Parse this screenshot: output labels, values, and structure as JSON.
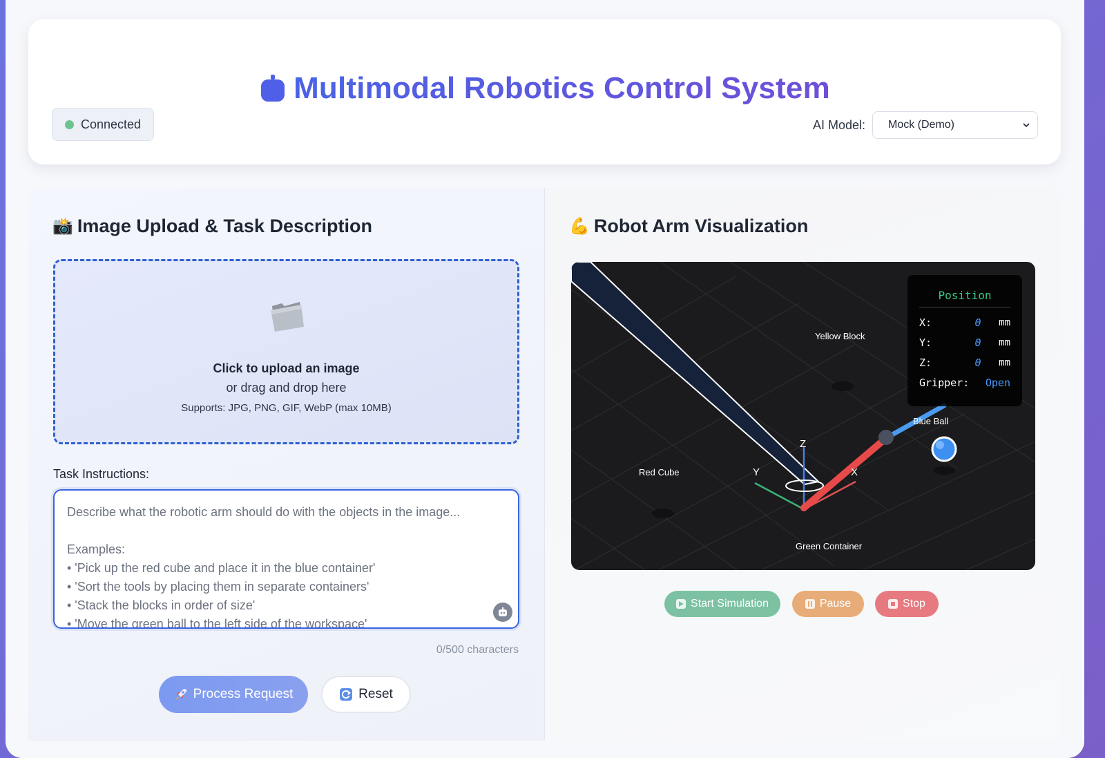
{
  "header": {
    "title": "Multimodal Robotics Control System",
    "title_icon": "robot-icon",
    "status": "Connected",
    "status_color": "#6cc38f",
    "model_label": "AI Model:",
    "model_selected": "Mock (Demo)"
  },
  "left_panel": {
    "title": "Image Upload & Task Description",
    "title_icon": "camera-flash-icon",
    "upload": {
      "icon": "folder-icon",
      "main_text": "Click to upload an image",
      "sub_text": "or drag and drop here",
      "support_text": "Supports: JPG, PNG, GIF, WebP (max 10MB)"
    },
    "task_label": "Task Instructions:",
    "task_placeholder_lines": [
      "Describe what the robotic arm should do with the objects in the image...",
      "",
      "Examples:",
      "• 'Pick up the red cube and place it in the blue container'",
      "• 'Sort the tools by placing them in separate containers'",
      "• 'Stack the blocks in order of size'",
      "• 'Move the green ball to the left side of the workspace'"
    ],
    "char_count": "0/500 characters",
    "process_button": "Process Request",
    "reset_button": "Reset"
  },
  "right_panel": {
    "title": "Robot Arm Visualization",
    "title_icon": "flexed-arm-icon",
    "objects": {
      "yellow_block": "Yellow Block",
      "blue_ball": "Blue Ball",
      "red_cube": "Red Cube",
      "green_container": "Green Container"
    },
    "axes": {
      "x": "X",
      "y": "Y",
      "z": "Z"
    },
    "position": {
      "title": "Position",
      "x_label": "X:",
      "x_value": "0",
      "x_unit": "mm",
      "y_label": "Y:",
      "y_value": "0",
      "y_unit": "mm",
      "z_label": "Z:",
      "z_value": "0",
      "z_unit": "mm",
      "gripper_label": "Gripper:",
      "gripper_value": "Open"
    },
    "controls": {
      "start": "Start Simulation",
      "pause": "Pause",
      "stop": "Stop"
    }
  },
  "colors": {
    "accent": "#4a63e6",
    "start": "#7cc2a2",
    "pause": "#e8ac78",
    "stop": "#e77a80",
    "position_title": "#39c98a",
    "position_value": "#4a9bff"
  }
}
